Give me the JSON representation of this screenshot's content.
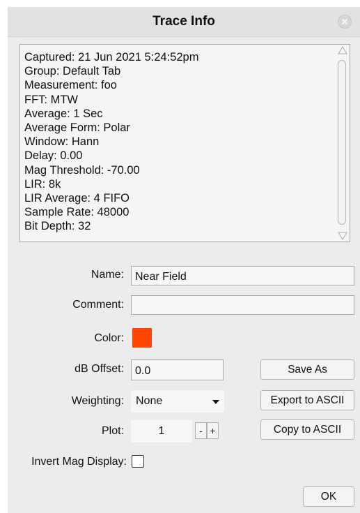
{
  "window": {
    "title": "Trace Info"
  },
  "info": {
    "lines": [
      "Captured: 21 Jun 2021 5:24:52pm",
      "Group: Default Tab",
      "Measurement: foo",
      "FFT: MTW",
      "Average: 1 Sec",
      "Average Form: Polar",
      "Window: Hann",
      "Delay: 0.00",
      "Mag Threshold: -70.00",
      "LIR: 8k",
      "LIR Average: 4 FIFO",
      "Sample Rate: 48000",
      "Bit Depth: 32"
    ]
  },
  "form": {
    "name_label": "Name:",
    "name_value": "Near Field",
    "comment_label": "Comment:",
    "comment_value": "",
    "color_label": "Color:",
    "color_value": "#ff4500",
    "db_offset_label": "dB Offset:",
    "db_offset_value": "0.0",
    "weighting_label": "Weighting:",
    "weighting_value": "None",
    "plot_label": "Plot:",
    "plot_value": "1",
    "plot_minus": "-",
    "plot_plus": "+",
    "invert_label": "Invert Mag Display:",
    "invert_checked": false
  },
  "buttons": {
    "save_as": "Save As",
    "export_ascii": "Export to ASCII",
    "copy_ascii": "Copy to ASCII",
    "ok": "OK"
  },
  "icons": {
    "close": "close-icon",
    "dropdown": "chevron-down-icon",
    "scroll_up": "triangle-up-icon",
    "scroll_down": "triangle-down-icon"
  }
}
